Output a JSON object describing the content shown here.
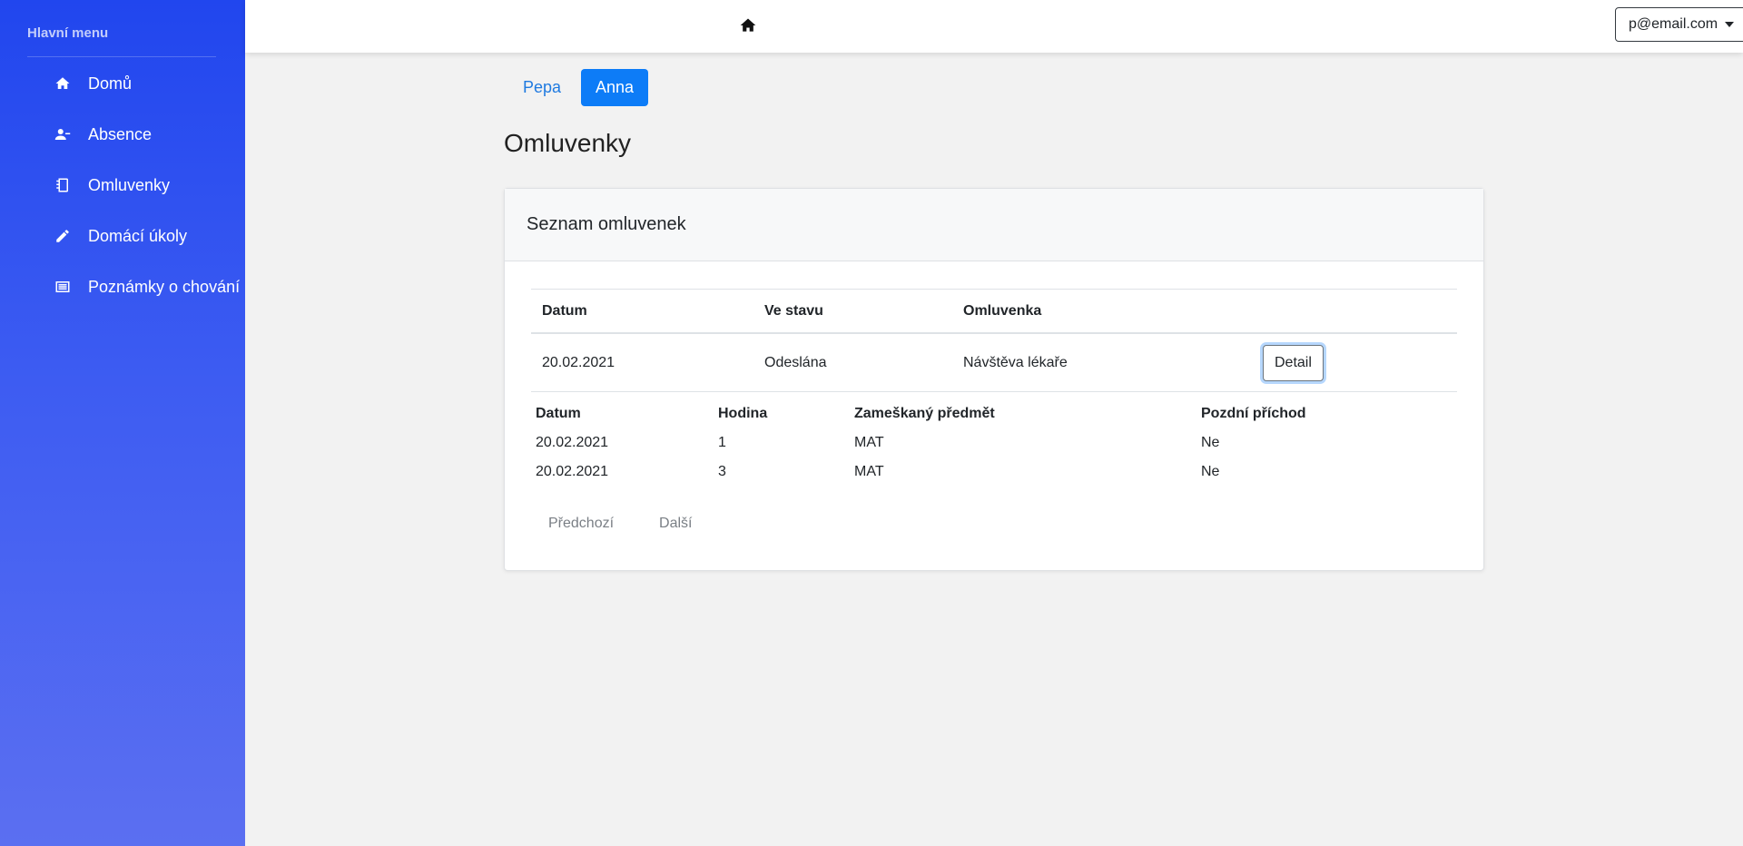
{
  "sidebar": {
    "heading": "Hlavní menu",
    "items": [
      {
        "label": "Domů",
        "icon": "home-icon"
      },
      {
        "label": "Absence",
        "icon": "user-minus-icon"
      },
      {
        "label": "Omluvenky",
        "icon": "notebook-icon"
      },
      {
        "label": "Domácí úkoly",
        "icon": "pencil-icon"
      },
      {
        "label": "Poznámky o chování",
        "icon": "list-icon"
      }
    ],
    "colors": {
      "gradient_top": "#2146ee",
      "gradient_bottom": "#5b6ff1"
    }
  },
  "topbar": {
    "home_icon": "home-icon",
    "user_email": "p@email.com"
  },
  "tabs": [
    {
      "label": "Pepa",
      "active": false
    },
    {
      "label": "Anna",
      "active": true
    }
  ],
  "page": {
    "title": "Omluvenky"
  },
  "card": {
    "header": "Seznam omluvenek",
    "table": {
      "columns": [
        "Datum",
        "Ve stavu",
        "Omluvenka"
      ],
      "rows": [
        {
          "datum": "20.02.2021",
          "stav": "Odeslána",
          "omluvenka": "Návštěva lékaře",
          "action": "Detail"
        }
      ]
    },
    "detail_table": {
      "columns": [
        "Datum",
        "Hodina",
        "Zameškaný předmět",
        "Pozdní příchod"
      ],
      "rows": [
        {
          "datum": "20.02.2021",
          "hodina": "1",
          "predmet": "MAT",
          "pozdni": "Ne"
        },
        {
          "datum": "20.02.2021",
          "hodina": "3",
          "predmet": "MAT",
          "pozdni": "Ne"
        }
      ]
    },
    "pagination": {
      "prev": "Předchozí",
      "next": "Další"
    }
  },
  "colors": {
    "accent": "#0d7cf7",
    "background": "#f2f2f2"
  }
}
